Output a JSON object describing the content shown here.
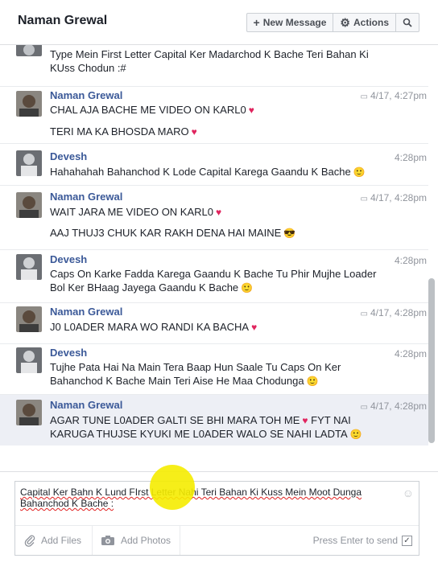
{
  "header": {
    "title": "Naman Grewal",
    "new_message": "New Message",
    "actions": "Actions"
  },
  "icons": {
    "plus": "plus-icon",
    "gear": "gear-icon",
    "search": "search-icon",
    "reply": "reply-icon",
    "heart": "heart-icon",
    "smiley": "smiley-icon"
  },
  "colors": {
    "name_link": "#3b5998",
    "heart": "#e0245e",
    "highlight_bg": "#edeff5"
  },
  "messages": [
    {
      "sender": "",
      "time": "",
      "lines": [
        "Type Mein First Letter Capital Ker Madarchod K Bache Teri Bahan Ki",
        "KUss Chodun :#"
      ]
    },
    {
      "sender": "Naman Grewal",
      "time": "4/17, 4:27pm",
      "lines": [
        "CHAL AJA BACHE ME VIDEO ON KARL0",
        "TERI MA KA BHOSDA MARO"
      ]
    },
    {
      "sender": "Devesh",
      "time": "4:28pm",
      "lines": [
        "Hahahahah Bahanchod K Lode Capital Karega Gaandu K Bache"
      ]
    },
    {
      "sender": "Naman Grewal",
      "time": "4/17, 4:28pm",
      "lines": [
        "WAIT JARA ME VIDEO ON KARL0",
        "AAJ THUJ3 CHUK KAR RAKH DENA HAI MAINE"
      ]
    },
    {
      "sender": "Devesh",
      "time": "4:28pm",
      "lines": [
        "Caps On Karke Fadda Karega Gaandu K Bache Tu Phir Mujhe Loader",
        "Bol Ker BHaag Jayega Gaandu K Bache"
      ]
    },
    {
      "sender": "Naman Grewal",
      "time": "4/17, 4:28pm",
      "lines": [
        "J0 L0ADER MARA WO RANDI KA BACHA"
      ]
    },
    {
      "sender": "Devesh",
      "time": "4:28pm",
      "lines": [
        "Tujhe Pata Hai Na Main Tera Baap Hun Saale Tu Caps On Ker",
        "Bahanchod K Bache Main Teri Aise He Maa Chodunga"
      ]
    },
    {
      "sender": "Naman Grewal",
      "time": "4/17, 4:28pm",
      "lines": [
        "AGAR TUNE L0ADER GALTI SE BHI MARA TOH ME",
        "KARUGA THUJSE KYUKI ME L0ADER WALO SE NAHI LADTA"
      ],
      "inline_after_first": "FYT NAI"
    }
  ],
  "composer": {
    "text": "Capital Ker Bahn K Lund FIrst Letter Nahi Teri Bahan Ki Kuss Mein Moot Dunga Bahanchod K Bache :",
    "add_files": "Add Files",
    "add_photos": "Add Photos",
    "press_enter": "Press Enter to send"
  }
}
